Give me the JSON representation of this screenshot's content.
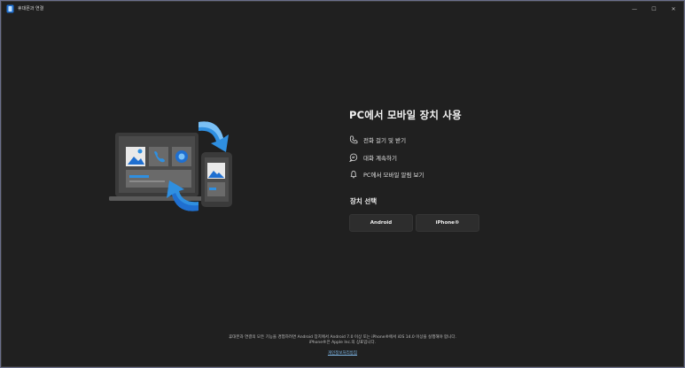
{
  "window": {
    "title": "휴대폰과 연결",
    "controls": {
      "minimize": "—",
      "maximize": "☐",
      "close": "✕"
    }
  },
  "main": {
    "headline": "PC에서 모바일 장치 사용",
    "features": [
      {
        "icon": "phone-icon",
        "label": "전화 걸기 및 받기"
      },
      {
        "icon": "chat-icon",
        "label": "대화 계속하기"
      },
      {
        "icon": "bell-icon",
        "label": "PC에서 모바일 알림 보기"
      }
    ],
    "device_section_title": "장치 선택",
    "device_buttons": {
      "android": "Android",
      "iphone": "iPhone®"
    }
  },
  "footer": {
    "line1": "휴대폰과 연결의 모든 기능을 경험하려면 Android 장치에서 Android 7.0 이상 또는 iPhone®에서 iOS 14.0 이상을 실행해야 합니다.",
    "line2": "iPhone®은 Apple Inc.의 상표입니다.",
    "privacy_link": "개인정보처리방침"
  },
  "colors": {
    "accent": "#2f8fe0",
    "background": "#202020",
    "button": "#2d2d2d"
  }
}
